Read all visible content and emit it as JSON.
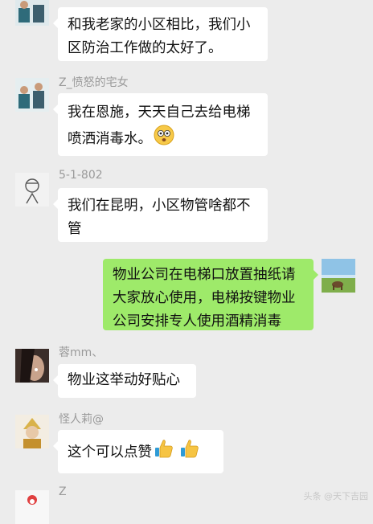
{
  "messages": [
    {
      "sender": "",
      "text": "和我老家的小区相比，我们小区防治工作做的太好了。"
    },
    {
      "sender": "Z_愤怒的宅女",
      "text": "我在恩施，天天自己去给电梯喷洒消毒水。",
      "emoji": "shocked-face-icon"
    },
    {
      "sender": "5-1-802",
      "text": "我们在昆明，小区物管啥都不管"
    },
    {
      "sender": "",
      "text": "物业公司在电梯口放置抽纸请大家放心使用，电梯按键物业公司安排专人使用酒精消毒"
    },
    {
      "sender": "蓉mm、",
      "text": "物业这举动好贴心"
    },
    {
      "sender": "怪人莉@",
      "text": "这个可以点赞",
      "emoji": "thumbs-up-icon"
    },
    {
      "sender": "Z",
      "text": ""
    }
  ],
  "watermark": "头条 @天下吉园",
  "colors": {
    "self_bubble": "#9eea6a",
    "other_bubble": "#ffffff",
    "background": "#ececec"
  }
}
